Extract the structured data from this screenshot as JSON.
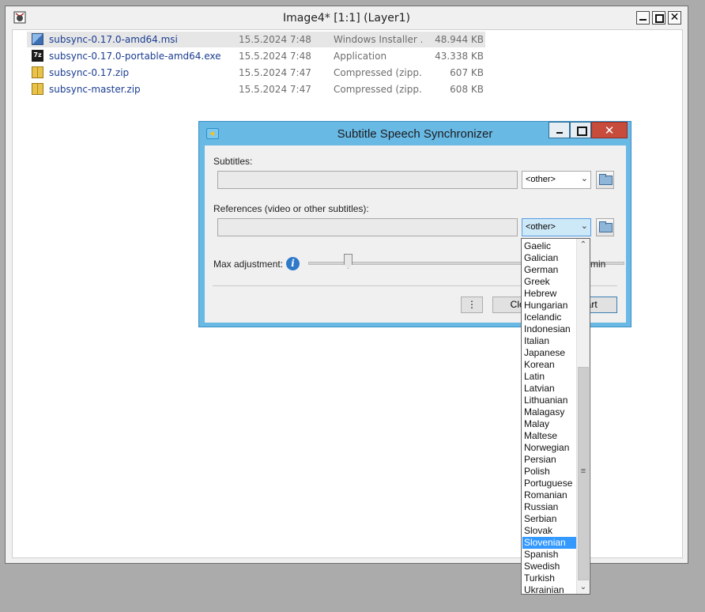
{
  "viewer": {
    "title": "Image4* [1:1] (Layer1)",
    "close_glyph": "✕"
  },
  "files": [
    {
      "name": "subsync-0.17.0-amd64.msi",
      "date": "15.5.2024 7:48",
      "type": "Windows Installer ...",
      "size": "48.944 KB",
      "icon": "msi-installer-icon"
    },
    {
      "name": "subsync-0.17.0-portable-amd64.exe",
      "date": "15.5.2024 7:48",
      "type": "Application",
      "size": "43.338 KB",
      "icon": "7zip-app-icon"
    },
    {
      "name": "subsync-0.17.zip",
      "date": "15.5.2024 7:47",
      "type": "Compressed (zipp...",
      "size": "607 KB",
      "icon": "zip-folder-icon"
    },
    {
      "name": "subsync-master.zip",
      "date": "15.5.2024 7:47",
      "type": "Compressed (zipp...",
      "size": "608 KB",
      "icon": "zip-folder-icon"
    }
  ],
  "dialog": {
    "title": "Subtitle Speech Synchronizer",
    "close_glyph": "✕",
    "subtitles_label": "Subtitles:",
    "subtitles_value": "",
    "subtitles_lang": "<other>",
    "references_label": "References (video or other subtitles):",
    "references_value": "",
    "references_lang": "<other>",
    "max_adjustment_label": "Max adjustment:",
    "info_glyph": "i",
    "max_adjustment_value": "0 min",
    "more_button": "⋮",
    "close_button": "Close",
    "start_button": "Start",
    "combo_arrow": "⌄"
  },
  "dropdown": {
    "items": [
      "Gaelic",
      "Galician",
      "German",
      "Greek",
      "Hebrew",
      "Hungarian",
      "Icelandic",
      "Indonesian",
      "Italian",
      "Japanese",
      "Korean",
      "Latin",
      "Latvian",
      "Lithuanian",
      "Malagasy",
      "Malay",
      "Maltese",
      "Norwegian",
      "Persian",
      "Polish",
      "Portuguese",
      "Romanian",
      "Russian",
      "Serbian",
      "Slovak",
      "Slovenian",
      "Spanish",
      "Swedish",
      "Turkish",
      "Ukrainian"
    ],
    "selected": "Slovenian",
    "scroll_up": "⌃",
    "scroll_down": "⌄",
    "grip": "≡"
  },
  "colors": {
    "dialog_frame": "#69b9e5",
    "dialog_close": "#c74c3c",
    "selection": "#3399ff",
    "file_link": "#1a3d91"
  }
}
